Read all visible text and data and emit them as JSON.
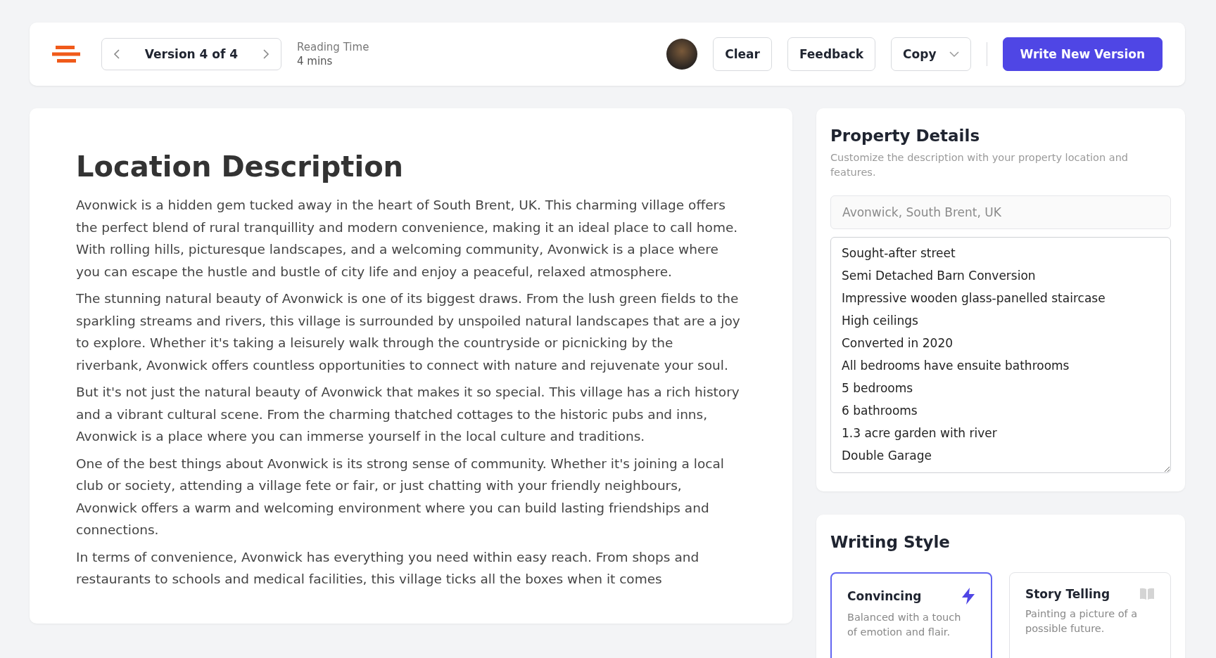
{
  "header": {
    "version_label": "Version 4 of 4",
    "reading_time_label": "Reading Time",
    "reading_time_value": "4 mins",
    "buttons": [
      {
        "kind": "plain",
        "label": "Clear"
      },
      {
        "kind": "plain",
        "label": "Feedback"
      },
      {
        "kind": "dropdown",
        "label": "Copy"
      },
      {
        "kind": "primary",
        "label": "Write New Version"
      }
    ]
  },
  "article": {
    "title": "Location Description",
    "paragraphs": [
      "Avonwick is a hidden gem tucked away in the heart of South Brent, UK. This charming village offers the perfect blend of rural tranquillity and modern convenience, making it an ideal place to call home. With rolling hills, picturesque landscapes, and a welcoming community, Avonwick is a place where you can escape the hustle and bustle of city life and enjoy a peaceful, relaxed atmosphere.",
      "The stunning natural beauty of Avonwick is one of its biggest draws. From the lush green fields to the sparkling streams and rivers, this village is surrounded by unspoiled natural landscapes that are a joy to explore. Whether it's taking a leisurely walk through the countryside or picnicking by the riverbank, Avonwick offers countless opportunities to connect with nature and rejuvenate your soul.",
      "But it's not just the natural beauty of Avonwick that makes it so special. This village has a rich history and a vibrant cultural scene. From the charming thatched cottages to the historic pubs and inns, Avonwick is a place where you can immerse yourself in the local culture and traditions.",
      "One of the best things about Avonwick is its strong sense of community. Whether it's joining a local club or society, attending a village fete or fair, or just chatting with your friendly neighbours, Avonwick offers a warm and welcoming environment where you can build lasting friendships and connections.",
      "In terms of convenience, Avonwick has everything you need within easy reach. From shops and restaurants to schools and medical facilities, this village ticks all the boxes when it comes"
    ]
  },
  "property_details": {
    "title": "Property Details",
    "subtitle": "Customize the description with your property location and features.",
    "location_placeholder": "Avonwick, South Brent, UK",
    "features": [
      "Sought-after street",
      "Semi Detached Barn Conversion",
      "Impressive wooden glass-panelled staircase",
      "High ceilings",
      "Converted in 2020",
      "All bedrooms have ensuite bathrooms",
      "5 bedrooms",
      "6 bathrooms",
      "1.3 acre garden with river",
      "Double Garage"
    ]
  },
  "writing_style": {
    "title": "Writing Style",
    "options": [
      {
        "kind": "bolt",
        "name": "Convincing",
        "description": "Balanced with a touch of emotion and flair.",
        "selected": true
      },
      {
        "kind": "book",
        "name": "Story Telling",
        "description": "Painting a picture of a possible future.",
        "selected": false
      }
    ]
  }
}
